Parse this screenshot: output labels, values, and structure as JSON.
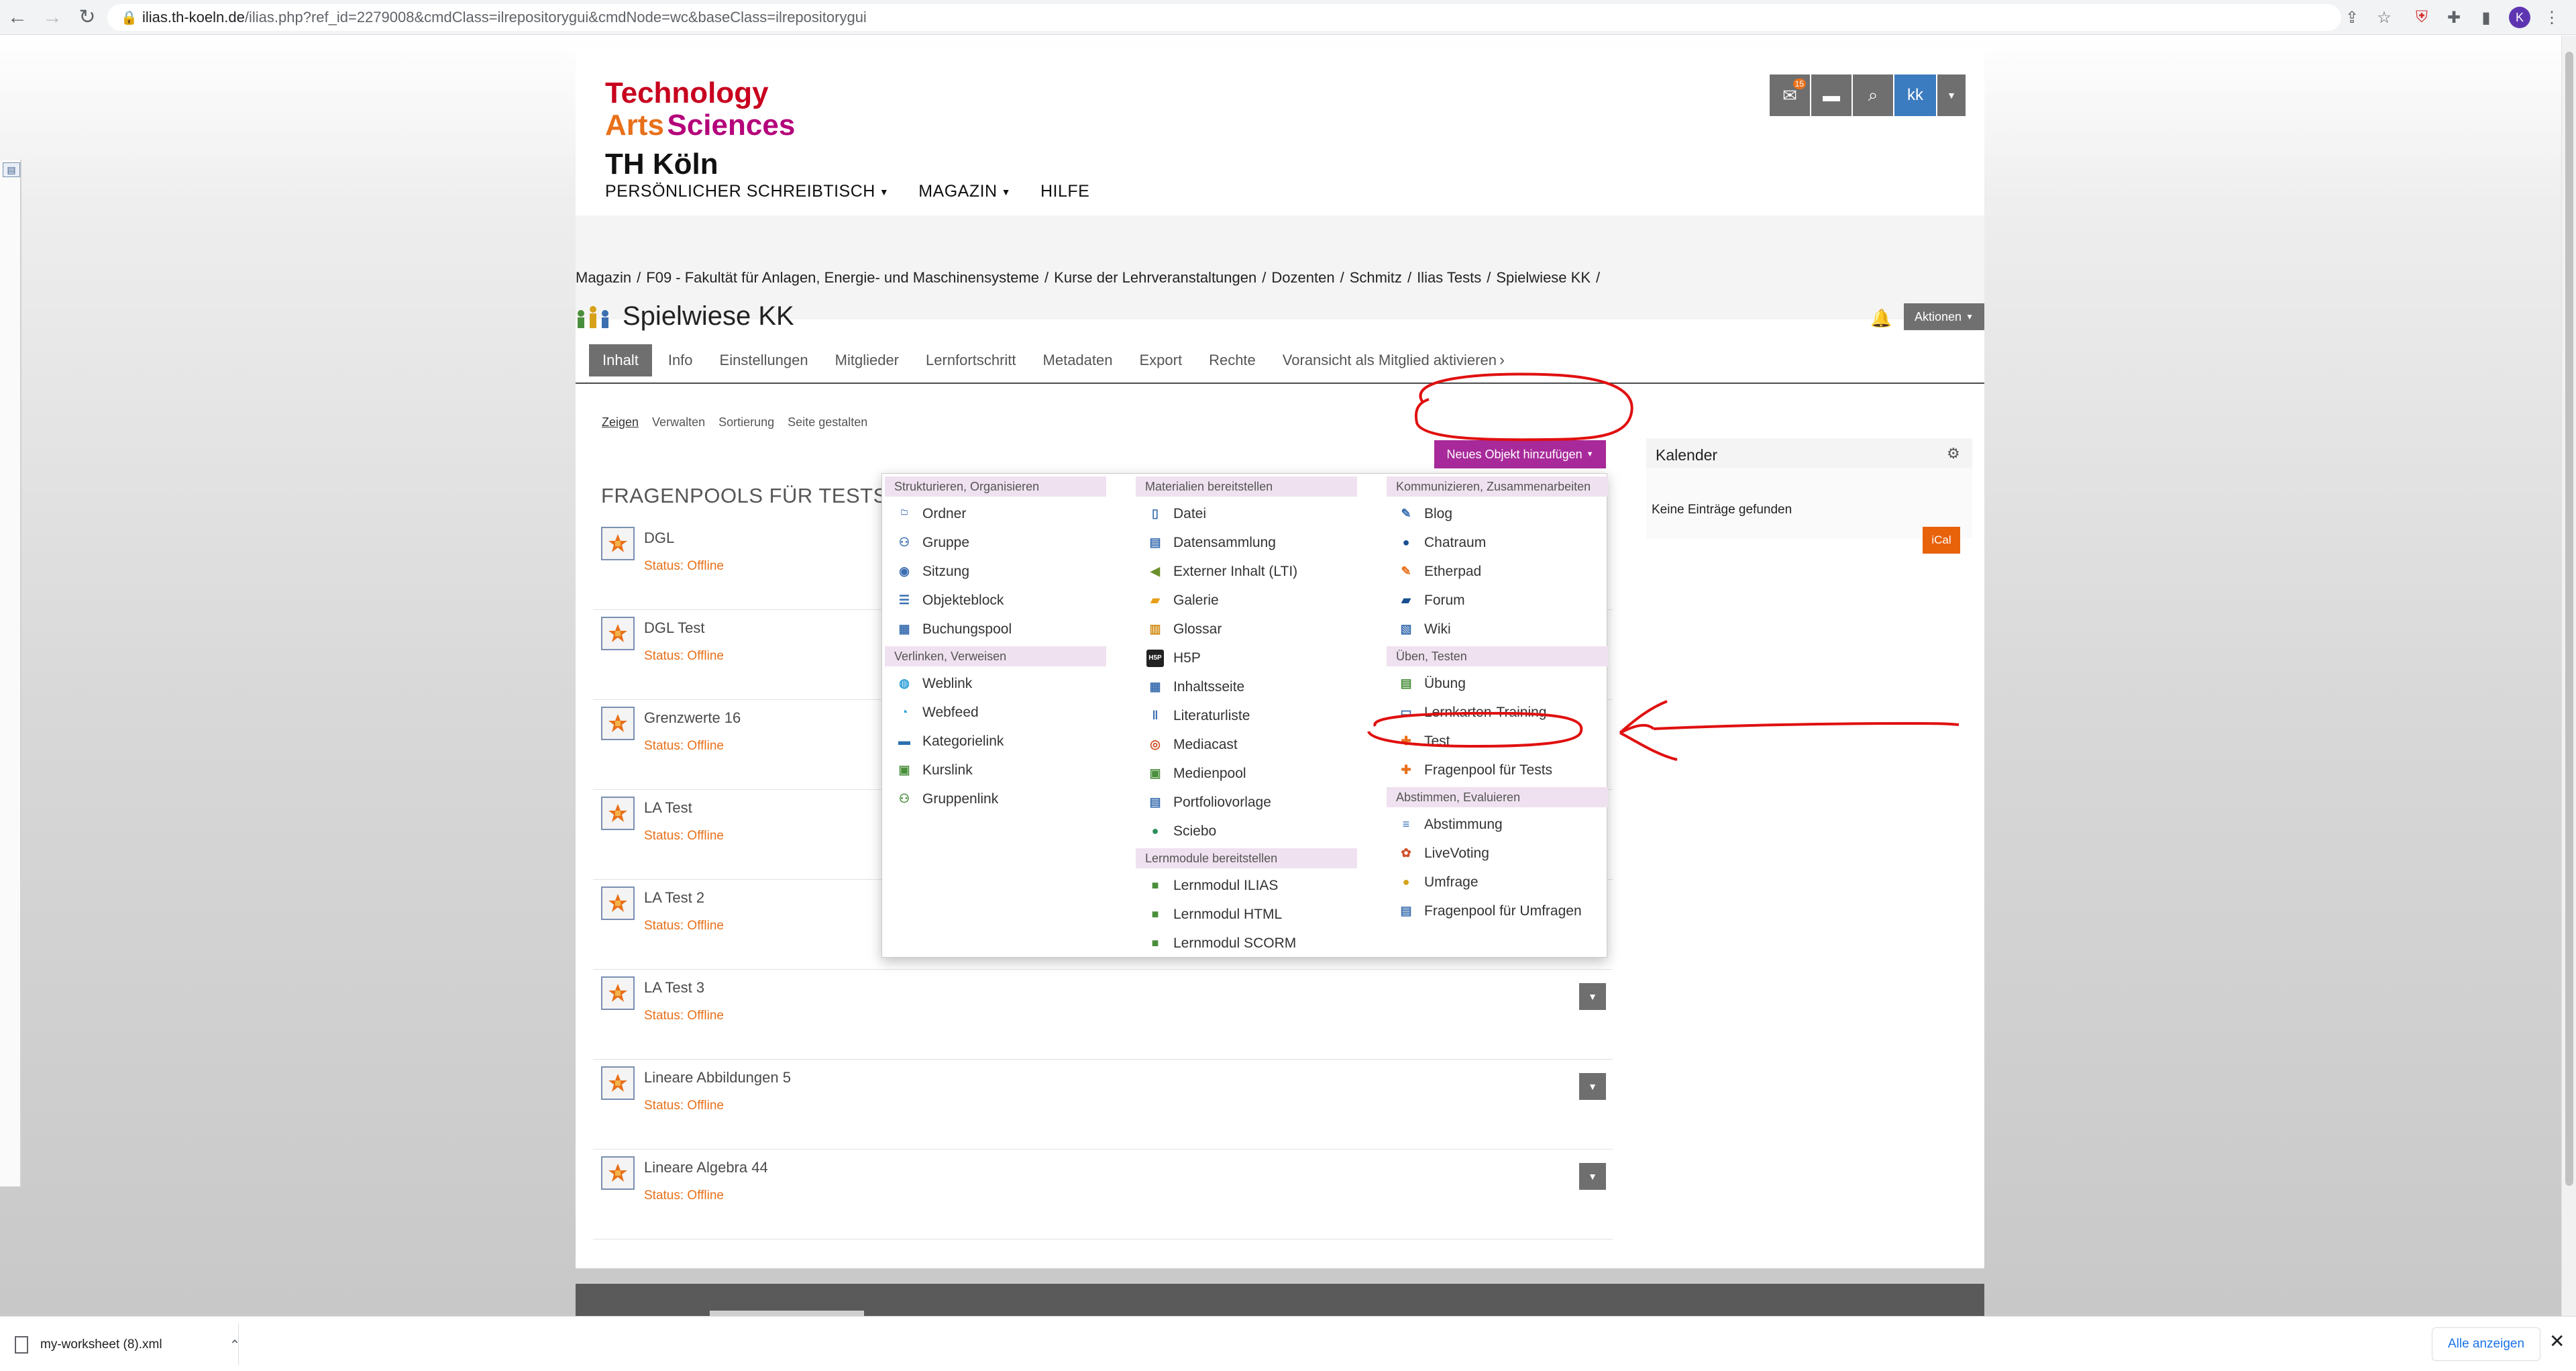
{
  "browser": {
    "url_host": "ilias.th-koeln.de",
    "url_path": "/ilias.php?ref_id=2279008&cmdClass=ilrepositorygui&cmdNode=wc&baseClass=ilrepositorygui",
    "profile_initial": "K"
  },
  "header": {
    "logo_line1": "Technology",
    "logo_line2a": "Arts",
    "logo_line2b": "Sciences",
    "logo_line3": "TH Köln",
    "mail_count": "15",
    "user_initials": "kk",
    "menu": [
      "PERSÖNLICHER SCHREIBTISCH",
      "MAGAZIN",
      "HILFE"
    ]
  },
  "breadcrumb": [
    "Magazin",
    "F09 - Fakultät für Anlagen, Energie- und Maschinensysteme",
    "Kurse der Lehrveranstaltungen",
    "Dozenten",
    "Schmitz",
    "Ilias Tests",
    "Spielwiese KK"
  ],
  "page": {
    "title": "Spielwiese KK",
    "actions_label": "Aktionen"
  },
  "tabs": [
    "Inhalt",
    "Info",
    "Einstellungen",
    "Mitglieder",
    "Lernfortschritt",
    "Metadaten",
    "Export",
    "Rechte",
    "Voransicht als Mitglied aktivieren"
  ],
  "subtabs": [
    "Zeigen",
    "Verwalten",
    "Sortierung",
    "Seite gestalten"
  ],
  "add_object_label": "Neues Objekt hinzufügen",
  "section_heading": "FRAGENPOOLS FÜR TESTS",
  "objects": [
    {
      "title": "DGL",
      "status": "Status: Offline"
    },
    {
      "title": "DGL Test",
      "status": "Status: Offline"
    },
    {
      "title": "Grenzwerte 16",
      "status": "Status: Offline"
    },
    {
      "title": "LA Test",
      "status": "Status: Offline"
    },
    {
      "title": "LA Test 2",
      "status": "Status: Offline"
    },
    {
      "title": "LA Test 3",
      "status": "Status: Offline"
    },
    {
      "title": "Lineare Abbildungen 5",
      "status": "Status: Offline"
    },
    {
      "title": "Lineare Algebra 44",
      "status": "Status: Offline"
    }
  ],
  "calendar": {
    "title": "Kalender",
    "empty": "Keine Einträge gefunden",
    "ical": "iCal"
  },
  "dropdown": {
    "col1": {
      "groups": [
        {
          "label": "Strukturieren, Organisieren",
          "items": [
            {
              "label": "Ordner",
              "icon": "folder-icon"
            },
            {
              "label": "Gruppe",
              "icon": "group-icon"
            },
            {
              "label": "Sitzung",
              "icon": "session-icon"
            },
            {
              "label": "Objekteblock",
              "icon": "itemgroup-icon"
            },
            {
              "label": "Buchungspool",
              "icon": "booking-icon"
            }
          ]
        },
        {
          "label": "Verlinken, Verweisen",
          "items": [
            {
              "label": "Weblink",
              "icon": "weblink-icon"
            },
            {
              "label": "Webfeed",
              "icon": "rss-icon"
            },
            {
              "label": "Kategorielink",
              "icon": "category-link-icon"
            },
            {
              "label": "Kurslink",
              "icon": "course-link-icon"
            },
            {
              "label": "Gruppenlink",
              "icon": "group-link-icon"
            }
          ]
        }
      ]
    },
    "col2": {
      "groups": [
        {
          "label": "Materialien bereitstellen",
          "items": [
            {
              "label": "Datei",
              "icon": "file-icon"
            },
            {
              "label": "Datensammlung",
              "icon": "datacollection-icon"
            },
            {
              "label": "Externer Inhalt (LTI)",
              "icon": "lti-icon"
            },
            {
              "label": "Galerie",
              "icon": "gallery-icon"
            },
            {
              "label": "Glossar",
              "icon": "glossary-icon"
            },
            {
              "label": "H5P",
              "icon": "h5p-icon"
            },
            {
              "label": "Inhaltsseite",
              "icon": "contentpage-icon"
            },
            {
              "label": "Literaturliste",
              "icon": "bibliography-icon"
            },
            {
              "label": "Mediacast",
              "icon": "mediacast-icon"
            },
            {
              "label": "Medienpool",
              "icon": "mediapool-icon"
            },
            {
              "label": "Portfoliovorlage",
              "icon": "portfolio-template-icon"
            },
            {
              "label": "Sciebo",
              "icon": "sciebo-icon"
            }
          ]
        },
        {
          "label": "Lernmodule bereitstellen",
          "items": [
            {
              "label": "Lernmodul ILIAS",
              "icon": "lm-ilias-icon"
            },
            {
              "label": "Lernmodul HTML",
              "icon": "lm-html-icon"
            },
            {
              "label": "Lernmodul SCORM",
              "icon": "lm-scorm-icon"
            }
          ]
        }
      ]
    },
    "col3": {
      "groups": [
        {
          "label": "Kommunizieren, Zusammenarbeiten",
          "items": [
            {
              "label": "Blog",
              "icon": "blog-icon"
            },
            {
              "label": "Chatraum",
              "icon": "chat-icon"
            },
            {
              "label": "Etherpad",
              "icon": "etherpad-icon"
            },
            {
              "label": "Forum",
              "icon": "forum-icon"
            },
            {
              "label": "Wiki",
              "icon": "wiki-icon"
            }
          ]
        },
        {
          "label": "Üben, Testen",
          "items": [
            {
              "label": "Übung",
              "icon": "exercise-icon"
            },
            {
              "label": "Lernkarten-Training",
              "icon": "flashcards-icon"
            },
            {
              "label": "Test",
              "icon": "test-icon"
            },
            {
              "label": "Fragenpool für Tests",
              "icon": "question-pool-icon"
            }
          ]
        },
        {
          "label": "Abstimmen, Evaluieren",
          "items": [
            {
              "label": "Abstimmung",
              "icon": "poll-icon"
            },
            {
              "label": "LiveVoting",
              "icon": "livevoting-icon"
            },
            {
              "label": "Umfrage",
              "icon": "survey-icon"
            },
            {
              "label": "Fragenpool für Umfragen",
              "icon": "survey-pool-icon"
            }
          ]
        }
      ]
    }
  },
  "download_bar": {
    "file_name": "my-worksheet (8).xml",
    "show_all": "Alle anzeigen"
  },
  "colors": {
    "accent_purple": "#a82a9a",
    "status_orange": "#e8701a",
    "annotation_red": "#e01010",
    "logo_red": "#c8001e"
  }
}
